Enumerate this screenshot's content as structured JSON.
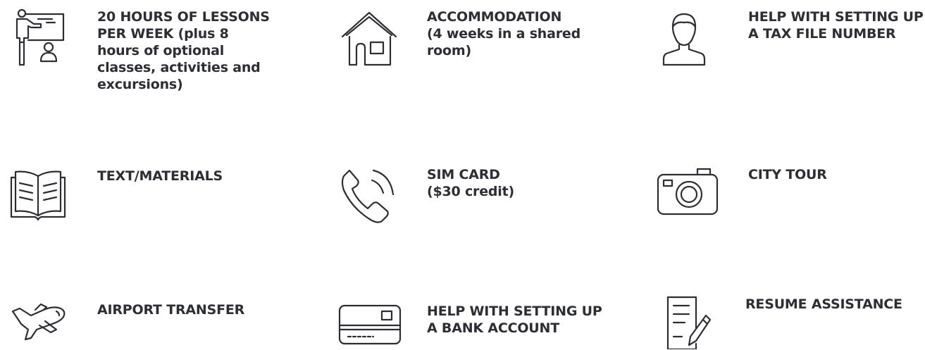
{
  "colors": {
    "ink": "#2d2e34",
    "background": "#ffffff"
  },
  "features": [
    {
      "id": "lessons",
      "icon": "teacher-presentation-icon",
      "lines": [
        "20 HOURS OF LESSONS",
        "PER WEEK (plus 8",
        "hours of optional",
        "classes, activities and",
        "excursions)"
      ]
    },
    {
      "id": "accommodation",
      "icon": "house-icon",
      "lines": [
        "ACCOMMODATION",
        "(4 weeks in a shared",
        "room)"
      ]
    },
    {
      "id": "tax-file-number",
      "icon": "person-icon",
      "lines": [
        "HELP WITH SETTING UP",
        "A TAX FILE NUMBER"
      ]
    },
    {
      "id": "materials",
      "icon": "open-book-icon",
      "lines": [
        "TEXT/MATERIALS"
      ]
    },
    {
      "id": "sim-card",
      "icon": "phone-icon",
      "lines": [
        "SIM CARD",
        "($30 credit)"
      ]
    },
    {
      "id": "city-tour",
      "icon": "camera-icon",
      "lines": [
        "CITY TOUR"
      ]
    },
    {
      "id": "airport-transfer",
      "icon": "airplane-icon",
      "lines": [
        "AIRPORT TRANSFER"
      ]
    },
    {
      "id": "bank-account",
      "icon": "credit-card-icon",
      "lines": [
        "HELP WITH SETTING UP",
        "A BANK ACCOUNT"
      ]
    },
    {
      "id": "resume",
      "icon": "document-pen-icon",
      "lines": [
        "RESUME ASSISTANCE"
      ]
    }
  ]
}
